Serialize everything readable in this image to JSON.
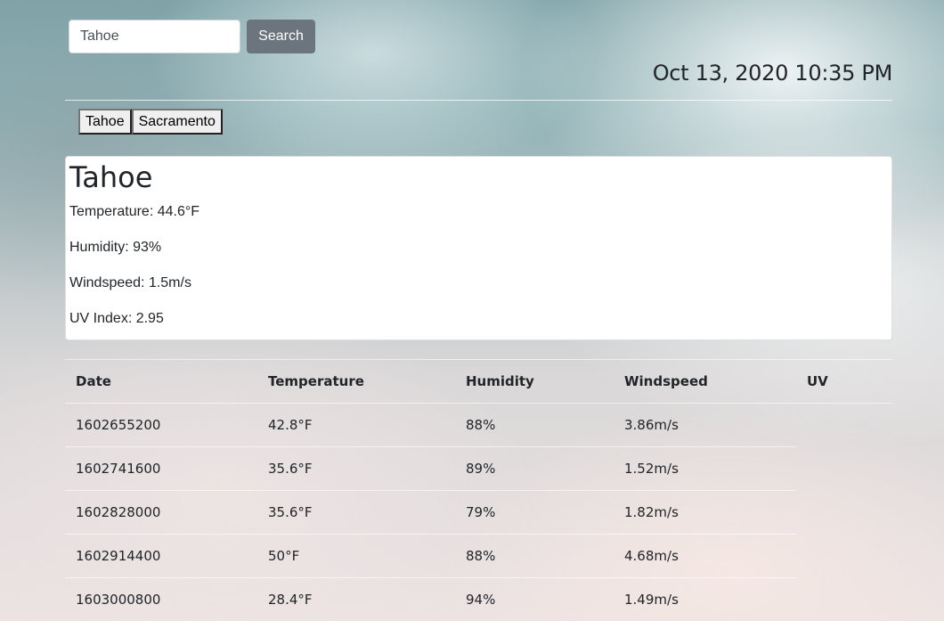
{
  "search": {
    "value": "Tahoe",
    "button_label": "Search"
  },
  "datetime": "Oct 13, 2020 10:35 PM",
  "history": [
    "Tahoe",
    "Sacramento"
  ],
  "current": {
    "city": "Tahoe",
    "temperature": "Temperature: 44.6°F",
    "humidity": "Humidity: 93%",
    "windspeed": "Windspeed: 1.5m/s",
    "uv_index": "UV Index: 2.95"
  },
  "forecast": {
    "headers": [
      "Date",
      "Temperature",
      "Humidity",
      "Windspeed",
      "UV"
    ],
    "rows": [
      [
        "1602655200",
        "42.8°F",
        "88%",
        "3.86m/s",
        ""
      ],
      [
        "1602741600",
        "35.6°F",
        "89%",
        "1.52m/s",
        ""
      ],
      [
        "1602828000",
        "35.6°F",
        "79%",
        "1.82m/s",
        ""
      ],
      [
        "1602914400",
        "50°F",
        "88%",
        "4.68m/s",
        ""
      ],
      [
        "1603000800",
        "28.4°F",
        "94%",
        "1.49m/s",
        ""
      ]
    ]
  }
}
